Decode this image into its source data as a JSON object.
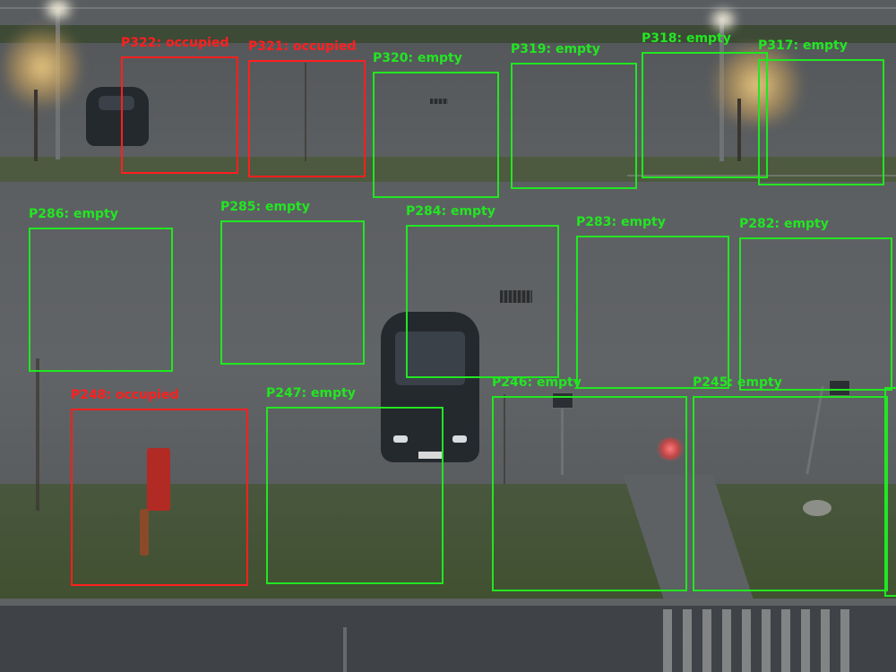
{
  "colors": {
    "occupied": "#ff1f1f",
    "empty": "#22e622"
  },
  "spots": [
    {
      "label": "P322: occupied",
      "status": "occupied"
    },
    {
      "label": "P321: occupied",
      "status": "occupied"
    },
    {
      "label": "P320: empty",
      "status": "empty"
    },
    {
      "label": "P319: empty",
      "status": "empty"
    },
    {
      "label": "P318: empty",
      "status": "empty"
    },
    {
      "label": "P317: empty",
      "status": "empty"
    },
    {
      "label": "P286: empty",
      "status": "empty"
    },
    {
      "label": "P285: empty",
      "status": "empty"
    },
    {
      "label": "P284: empty",
      "status": "empty"
    },
    {
      "label": "P283: empty",
      "status": "empty"
    },
    {
      "label": "P282: empty",
      "status": "empty"
    },
    {
      "label": "P248: occupied",
      "status": "occupied"
    },
    {
      "label": "P247: empty",
      "status": "empty"
    },
    {
      "label": "P246: empty",
      "status": "empty"
    },
    {
      "label": "P245: empty",
      "status": "empty"
    }
  ]
}
